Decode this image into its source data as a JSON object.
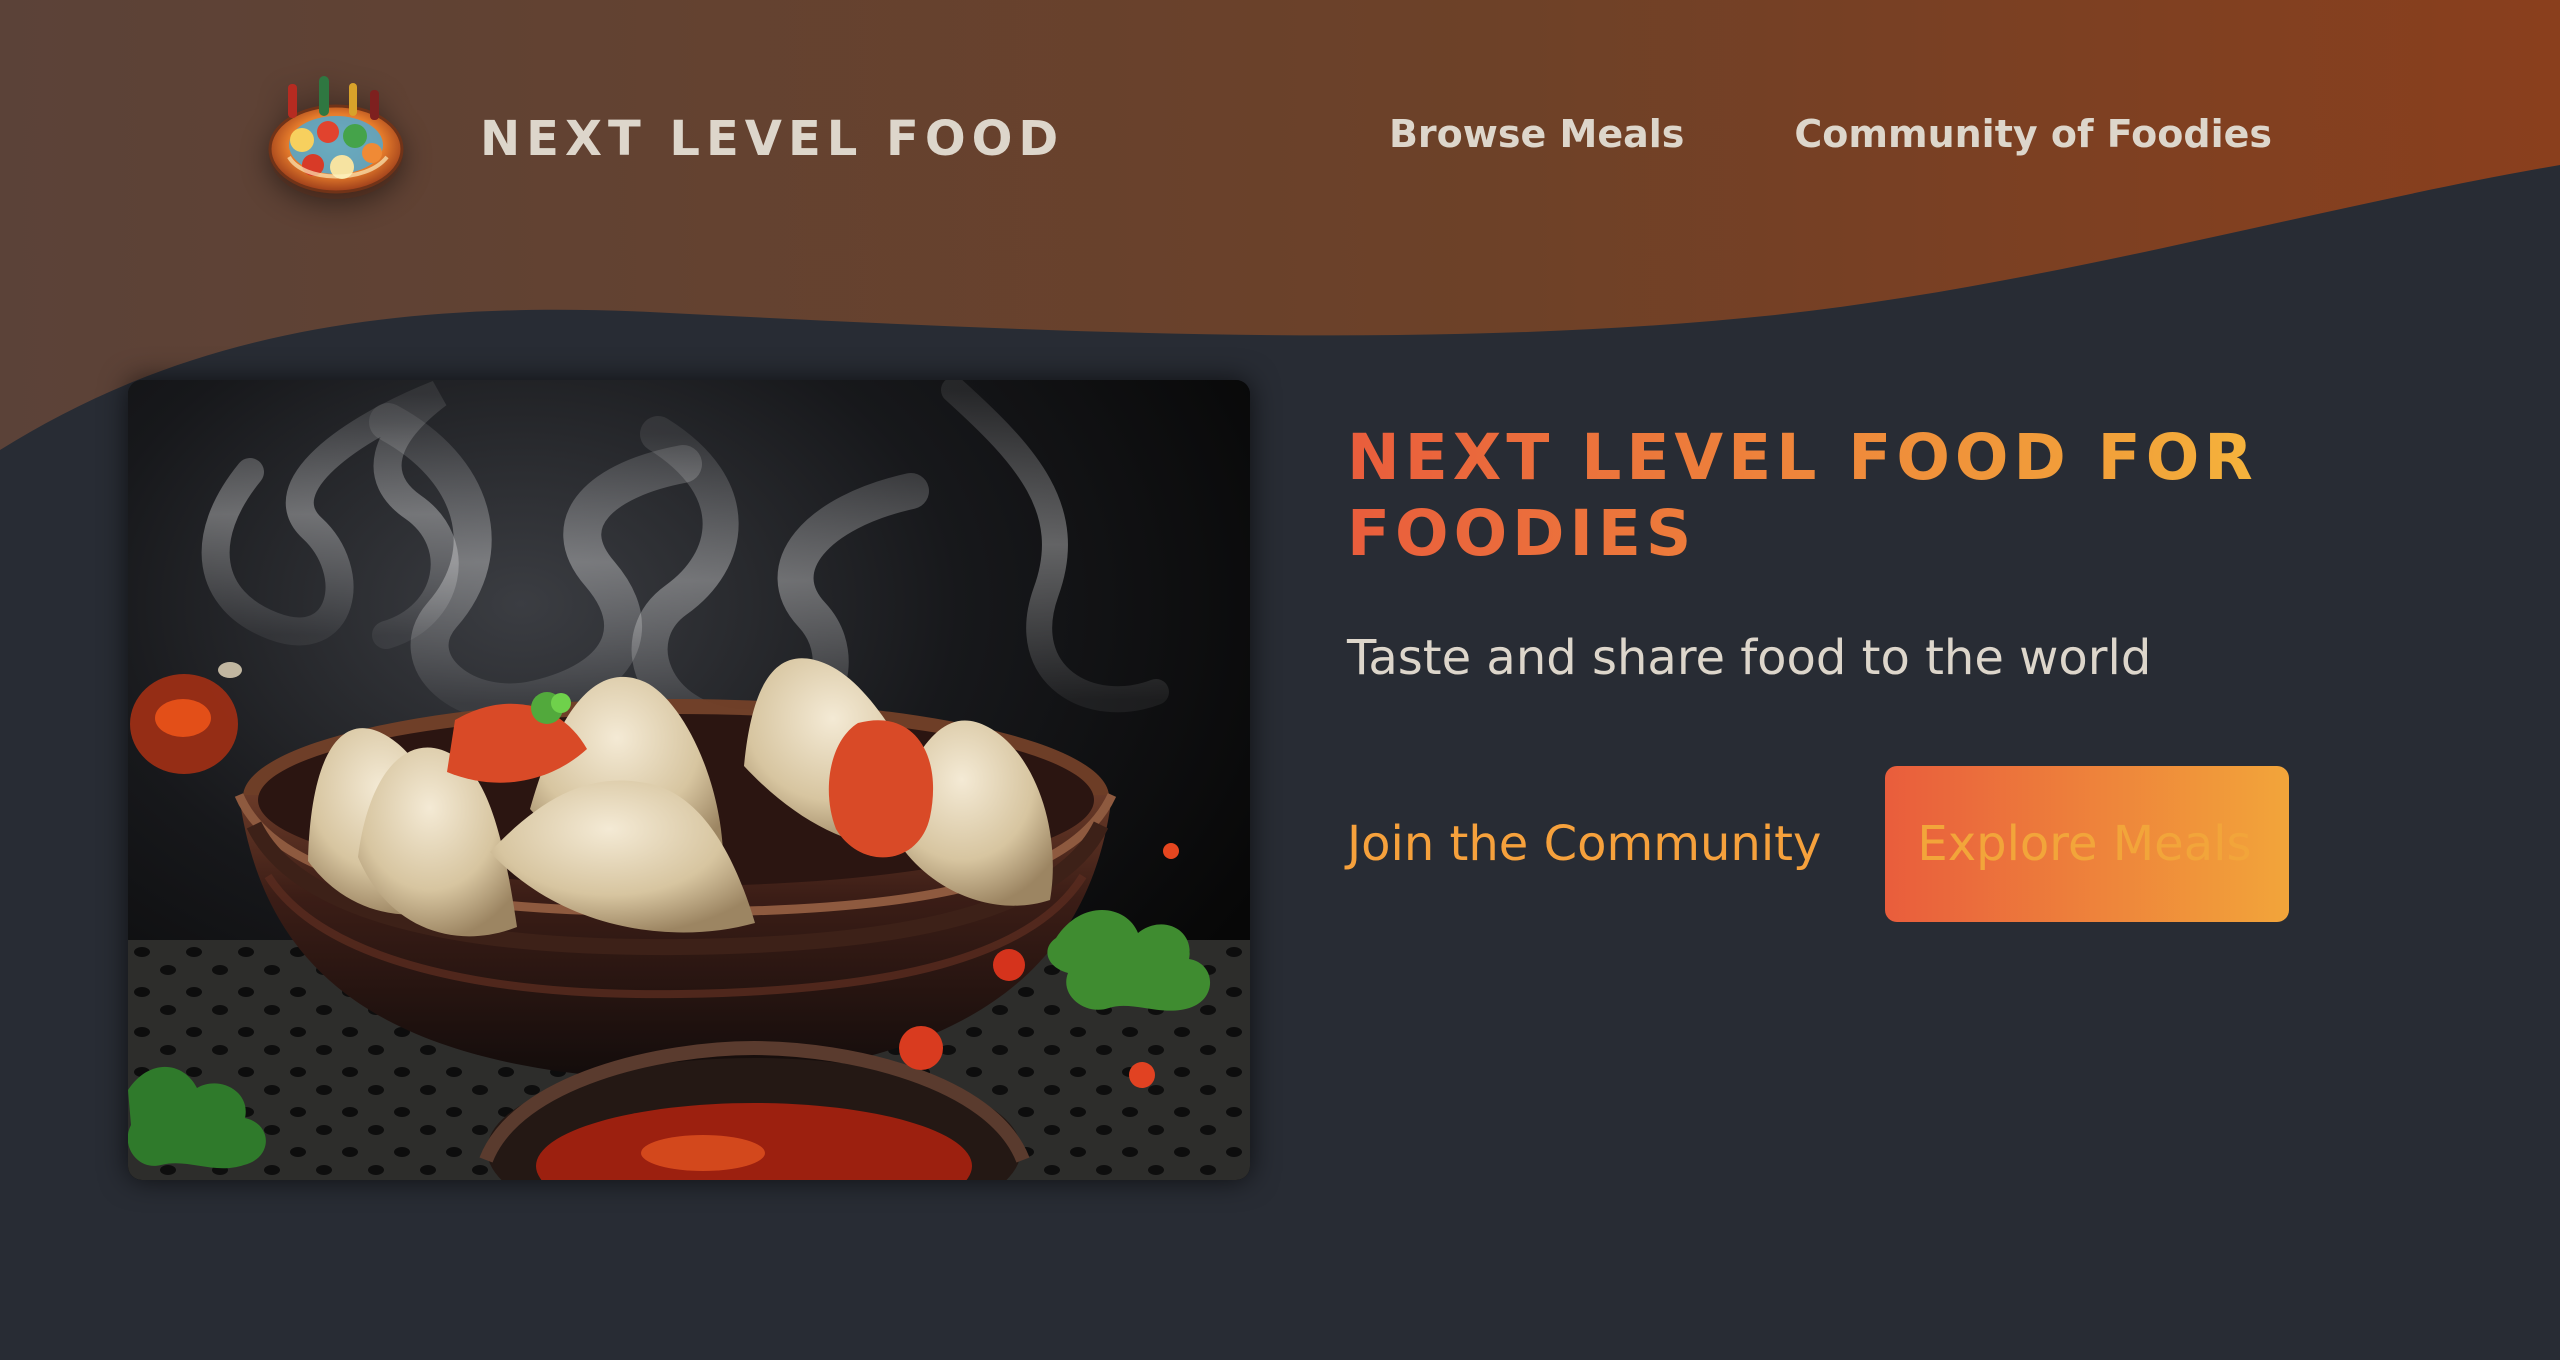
{
  "site": {
    "brand_name": "NEXT LEVEL FOOD",
    "logo_icon": "food-platter-icon"
  },
  "nav": {
    "items": [
      {
        "label": "Browse Meals"
      },
      {
        "label": "Community of Foodies"
      }
    ]
  },
  "hero": {
    "image_description_icon": "steamed-dumplings-image",
    "title": "NEXT LEVEL FOOD FOR FOODIES",
    "subtitle": "Taste and share food to the world",
    "primary_link": "Join the Community",
    "cta_button": "Explore Meals"
  },
  "colors": {
    "background": "#282c34",
    "header_gradient_start": "#5b4238",
    "header_gradient_end": "#8a3f1d",
    "accent_orange": "#e95d3c",
    "accent_yellow": "#f2a53a",
    "text_light": "#ddd6cb"
  }
}
